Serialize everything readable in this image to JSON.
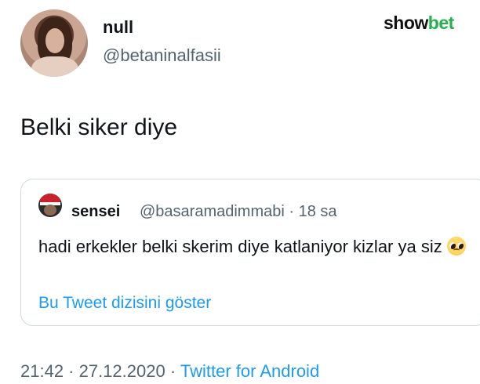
{
  "author": {
    "display_name": "null",
    "handle": "@betaninalfasii"
  },
  "watermark": {
    "part1": "show",
    "part2": "bet",
    "colors": {
      "part1": "#111111",
      "part2": "#22b14c"
    }
  },
  "tweet": {
    "text": "Belki siker diye"
  },
  "quoted_tweet": {
    "display_name": "sensei",
    "handle_time": "@basaramadimmabi · 18 sa",
    "text": "hadi erkekler belki skerim diye katlaniyor kizlar ya siz",
    "emoji": "pleading-face-emoji",
    "show_thread_label": "Bu Tweet dizisini göster"
  },
  "meta": {
    "time_date": "21:42 · 27.12.2020 · ",
    "source": "Twitter for Android"
  },
  "colors": {
    "link": "#1d9bf0",
    "secondary_text": "#536471",
    "border": "#cfd9de"
  }
}
